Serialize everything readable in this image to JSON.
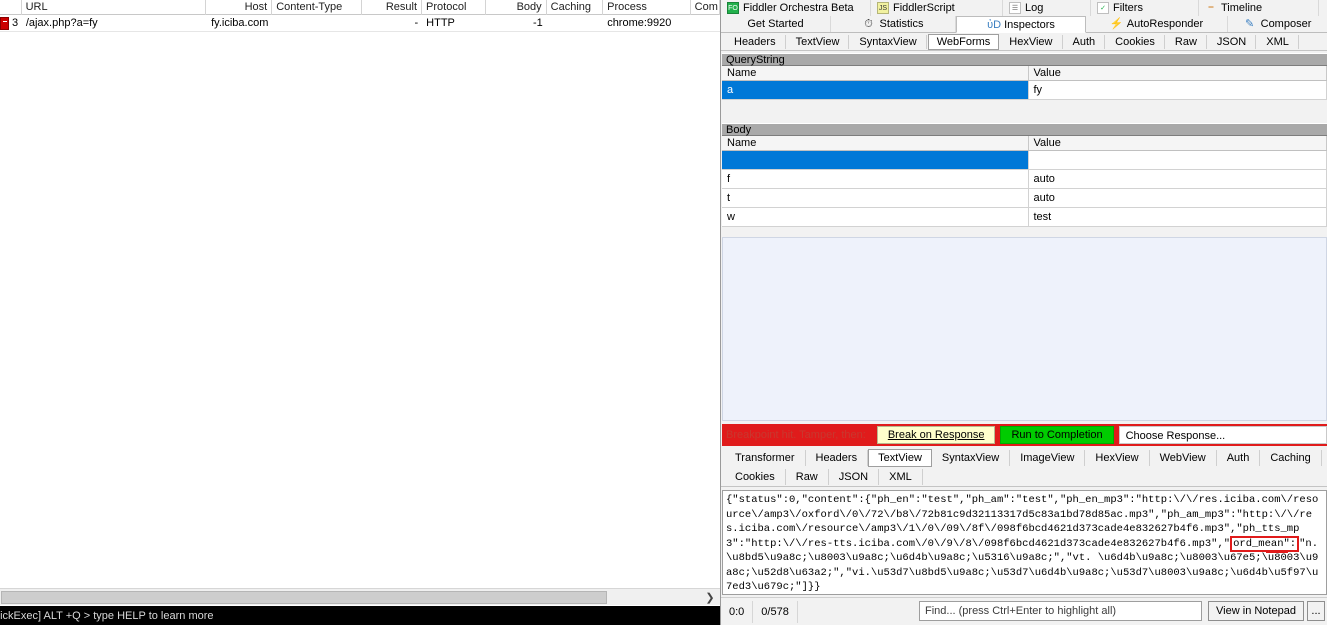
{
  "session_list": {
    "columns": [
      {
        "label": "",
        "width": 22,
        "align": "left"
      },
      {
        "label": "URL",
        "width": 190,
        "align": "left"
      },
      {
        "label": "Host",
        "width": 68,
        "align": "right"
      },
      {
        "label": "Content-Type",
        "width": 92,
        "align": "left"
      },
      {
        "label": "Result",
        "width": 62,
        "align": "right"
      },
      {
        "label": "Protocol",
        "width": 66,
        "align": "left"
      },
      {
        "label": "Body",
        "width": 62,
        "align": "right"
      },
      {
        "label": "Caching",
        "width": 58,
        "align": "left"
      },
      {
        "label": "Process",
        "width": 90,
        "align": "left"
      },
      {
        "label": "Com",
        "width": 30,
        "align": "left"
      }
    ],
    "rows": [
      {
        "icon": "breakpoint-icon",
        "id": "3",
        "url": "/ajax.php?a=fy",
        "host": "fy.iciba.com",
        "content_type": "",
        "result": "-",
        "protocol": "HTTP",
        "body": "-1",
        "caching": "",
        "process": "chrome:9920",
        "comments": ""
      }
    ]
  },
  "quickexec": {
    "text": "uickExec] ALT +Q > type HELP to learn more"
  },
  "toolbar_top": {
    "items": [
      {
        "label": "Fiddler Orchestra Beta",
        "icon": "orchestra-icon",
        "width": 150
      },
      {
        "label": "FiddlerScript",
        "icon": "fiddlerscript-icon",
        "width": 132
      },
      {
        "label": "Log",
        "icon": "log-icon",
        "width": 88
      },
      {
        "label": "Filters",
        "icon": "filters-icon",
        "width": 108
      },
      {
        "label": "Timeline",
        "icon": "timeline-icon",
        "width": 120
      }
    ]
  },
  "main_tabs": {
    "items": [
      {
        "label": "Get Started",
        "icon": "",
        "active": false,
        "width": 110
      },
      {
        "label": "Statistics",
        "icon": "statistics-icon",
        "active": false,
        "width": 125
      },
      {
        "label": "Inspectors",
        "icon": "inspectors-icon",
        "active": true,
        "width": 130
      },
      {
        "label": "AutoResponder",
        "icon": "autoresponder-icon",
        "active": false,
        "width": 142
      },
      {
        "label": "Composer",
        "icon": "composer-icon",
        "active": false,
        "width": 100
      }
    ]
  },
  "request_tabs": {
    "items": [
      {
        "label": "Headers",
        "active": false
      },
      {
        "label": "TextView",
        "active": false
      },
      {
        "label": "SyntaxView",
        "active": false
      },
      {
        "label": "WebForms",
        "active": true
      },
      {
        "label": "HexView",
        "active": false
      },
      {
        "label": "Auth",
        "active": false
      },
      {
        "label": "Cookies",
        "active": false
      },
      {
        "label": "Raw",
        "active": false
      },
      {
        "label": "JSON",
        "active": false
      },
      {
        "label": "XML",
        "active": false
      }
    ]
  },
  "querystring": {
    "title": "QueryString",
    "headers": {
      "name": "Name",
      "value": "Value"
    },
    "rows": [
      {
        "name": "a",
        "value": "fy",
        "selected": true
      }
    ]
  },
  "body_form": {
    "title": "Body",
    "headers": {
      "name": "Name",
      "value": "Value"
    },
    "rows": [
      {
        "name": "",
        "value": "",
        "selected": true
      },
      {
        "name": "f",
        "value": "auto",
        "selected": false
      },
      {
        "name": "t",
        "value": "auto",
        "selected": false
      },
      {
        "name": "w",
        "value": "test",
        "selected": false
      }
    ]
  },
  "breakpoint_bar": {
    "label": "Breakpoint hit. Tamper, then:",
    "break_on_response": "Break on Response",
    "break_on_response_accel": "B",
    "run_to_completion": "Run to Completion",
    "run_to_completion_accel": "C",
    "choose_response": "Choose Response...",
    "bar_color": "#e01b1b",
    "run_button_color": "#00cc00",
    "break_button_color": "#ffffcc"
  },
  "response_tabs": {
    "row1": [
      {
        "label": "Transformer",
        "active": false
      },
      {
        "label": "Headers",
        "active": false
      },
      {
        "label": "TextView",
        "active": true
      },
      {
        "label": "SyntaxView",
        "active": false
      },
      {
        "label": "ImageView",
        "active": false
      },
      {
        "label": "HexView",
        "active": false
      },
      {
        "label": "WebView",
        "active": false
      },
      {
        "label": "Auth",
        "active": false
      },
      {
        "label": "Caching",
        "active": false
      }
    ],
    "row2": [
      {
        "label": "Cookies",
        "active": false
      },
      {
        "label": "Raw",
        "active": false
      },
      {
        "label": "JSON",
        "active": false
      },
      {
        "label": "XML",
        "active": false
      }
    ]
  },
  "response_body": {
    "part1": "{\"status\":0,\"content\":{\"ph_en\":\"test\",\"ph_am\":\"test\",\"ph_en_mp3\":\"http:\\/\\/res.iciba.com\\/resource\\/amp3\\/oxford\\/0\\/72\\/b8\\/72b81c9d32113317d5c83a1bd78d85ac.mp3\",\"ph_am_mp3\":\"http:\\/\\/res.iciba.com\\/resource\\/amp3\\/1\\/0\\/09\\/8f\\/098f6bcd4621d373cade4e832627b4f6.mp3\",\"ph_tts_mp3\":\"http:\\/\\/res-tts.iciba.com\\/0\\/9\\/8\\/098f6bcd4621d373cade4e832627b4f6.mp3\",\"",
    "highlight": "ord_mean\":",
    "part2": "\"n. \\u8bd5\\u9a8c;\\u8003\\u9a8c;\\u6d4b\\u9a8c;\\u5316\\u9a8c;\",\"vt. \\u6d4b\\u9a8c;\\u8003\\u67e5;\\u8003\\u9a8c;\\u52d8\\u63a2;\",\"vi.\\u53d7\\u8bd5\\u9a8c;\\u53d7\\u6d4b\\u9a8c;\\u53d7\\u8003\\u9a8c;\\u6d4b\\u5f97\\u7ed3\\u679c;\"]}}",
    "highlight_color": "#e01b1b"
  },
  "status_bar": {
    "cursor_position": "0:0",
    "selection_count": "0/578",
    "find_placeholder": "Find... (press Ctrl+Enter to highlight all)",
    "view_in_notepad": "View in Notepad",
    "more_button": "..."
  }
}
